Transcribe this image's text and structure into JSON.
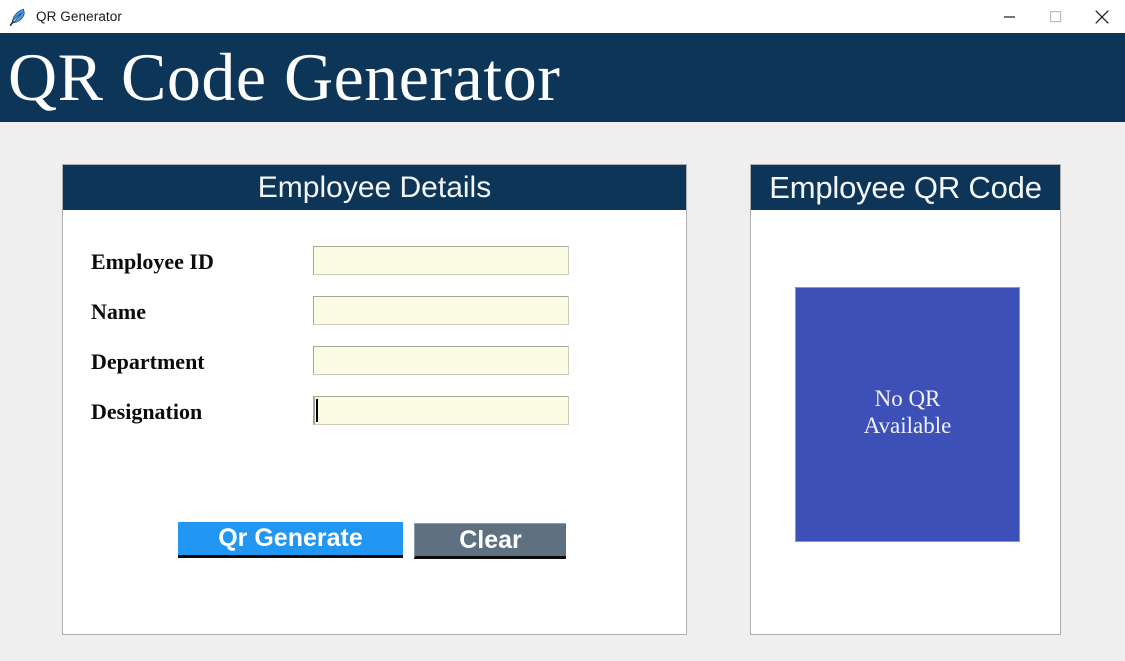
{
  "window": {
    "title": "QR Generator",
    "icon": "feather-icon",
    "controls": {
      "minimize": "minimize-icon",
      "maximize": "maximize-icon",
      "close": "close-icon"
    }
  },
  "header": {
    "title": "QR Code Generator",
    "background_color": "#0d3558",
    "text_color": "#fdfdfd"
  },
  "left_panel": {
    "title": "Employee Details",
    "fields": [
      {
        "label": "Employee ID",
        "value": "",
        "placeholder": "",
        "focused": false
      },
      {
        "label": "Name",
        "value": "",
        "placeholder": "",
        "focused": false
      },
      {
        "label": "Department",
        "value": "",
        "placeholder": "",
        "focused": false
      },
      {
        "label": "Designation",
        "value": "",
        "placeholder": "",
        "focused": true
      }
    ],
    "buttons": {
      "generate": "Qr Generate",
      "clear": "Clear"
    },
    "colors": {
      "generate_button": "#2196f3",
      "clear_button": "#5f7180",
      "input_background": "#fcfbe3"
    }
  },
  "right_panel": {
    "title": "Employee QR Code",
    "placeholder_text": "No QR\nAvailable",
    "placeholder_color": "#3d50b8"
  }
}
